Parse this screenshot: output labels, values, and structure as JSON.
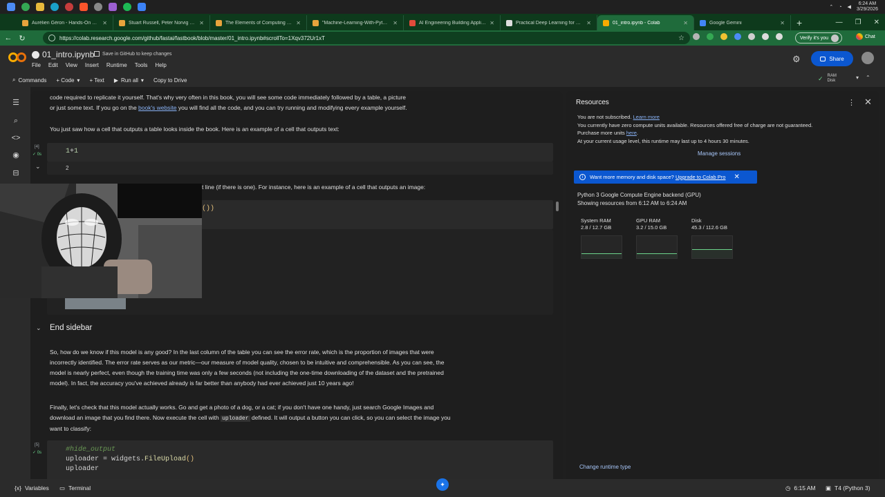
{
  "os": {
    "clock_time": "6:24 AM",
    "clock_date": "3/29/2026"
  },
  "tabs": [
    {
      "title": "Aurélien Géron - Hands-On Machi",
      "color": "#e8a33c"
    },
    {
      "title": "Stuart Russell, Peter Norvig - Artifi",
      "color": "#e8a33c"
    },
    {
      "title": "The Elements of Computing Syste",
      "color": "#e8a33c"
    },
    {
      "title": "\"Machine-Learning-With-Pytorch",
      "color": "#e8a33c"
    },
    {
      "title": "AI Engineering Building Applicatio",
      "color": "#e14b3b"
    },
    {
      "title": "Practical Deep Learning for Coders",
      "color": "#dddddd"
    },
    {
      "title": "01_intro.ipynb - Colab",
      "color": "#f9ab00",
      "active": true
    },
    {
      "title": "Google Gemini",
      "color": "#4285f4"
    }
  ],
  "address": {
    "url": "https://colab.research.google.com/github/fastai/fastbook/blob/master/01_intro.ipynb#scrollTo=1Xqv372Ur1xT",
    "verify_label": "Verify it's you",
    "chat_label": "Chat"
  },
  "colab": {
    "notebook_title": "01_intro.ipynb",
    "save_github": "Save in GitHub to keep changes",
    "menus": [
      "File",
      "Edit",
      "View",
      "Insert",
      "Runtime",
      "Tools",
      "Help"
    ],
    "share_label": "Share",
    "toolbar": {
      "commands": "Commands",
      "code": "+ Code",
      "text": "+ Text",
      "run_all": "Run all",
      "copy_drive": "Copy to Drive"
    },
    "ram_label": "RAM",
    "disk_label": "Disk"
  },
  "notebook": {
    "p1": "code required to replicate it yourself. That's why very often in this book, you will see some code immediately followed by a table, a picture",
    "p1b_pre": "or just some text. If you go on the ",
    "p1b_link": "book's website",
    "p1b_post": " you will find all the code, and you can try running and modifying every example yourself.",
    "p2": "You just saw how a cell that outputs a table looks inside the book. Here is an example of a cell that outputs text:",
    "cell1_num": "[4]",
    "cell1_time": "✓ 0s",
    "cell1_code_a": "1",
    "cell1_code_op": "+",
    "cell1_code_b": "1",
    "cell1_output": "2",
    "p3_visible": "t line (if there is one). For instance, here is an example of a cell that outputs an image:",
    "cell2_visible_code": "())",
    "heading_end_sidebar": "End sidebar",
    "p4": "So, how do we know if this model is any good? In the last column of the table you can see the error rate, which is the proportion of images that were incorrectly identified. The error rate serves as our metric—our measure of model quality, chosen to be intuitive and comprehensible. As you can see, the model is nearly perfect, even though the training time was only a few seconds (not including the one-time downloading of the dataset and the pretrained model). In fact, the accuracy you've achieved already is far better than anybody had ever achieved just 10 years ago!",
    "p5_pre": "Finally, let's check that this model actually works. Go and get a photo of a dog, or a cat; if you don't have one handy, just search Google Images and download an image that you find there. Now execute the cell with ",
    "p5_code": "uploader",
    "p5_post": " defined. It will output a button you can click, so you can select the image you want to classify:",
    "cell3_num": "[5]",
    "cell3_time": "✓ 0s",
    "cell3_line1": "#hide_output",
    "cell3_line2_a": "uploader",
    "cell3_line2_b": " = widgets.",
    "cell3_line2_fn": "FileUpload",
    "cell3_line2_c": "()",
    "cell3_line3": "uploader"
  },
  "resources": {
    "title": "Resources",
    "line1": "You are not subscribed. ",
    "line1_link": "Learn more",
    "line2": "You currently have zero compute units available. Resources offered free of charge are not guaranteed.",
    "line3_pre": "Purchase more units ",
    "line3_link": "here",
    "line3_post": ".",
    "line4": "At your current usage level, this runtime may last up to 4 hours 30 minutes.",
    "manage_sessions": "Manage sessions",
    "banner_text": "Want more memory and disk space? ",
    "banner_link": "Upgrade to Colab Pro",
    "backend": "Python 3 Google Compute Engine backend (GPU)",
    "showing": "Showing resources from 6:12 AM to 6:24 AM",
    "gauges": [
      {
        "name": "System RAM",
        "value": "2.8 / 12.7 GB",
        "used": 0.22
      },
      {
        "name": "GPU RAM",
        "value": "3.2 / 15.0 GB",
        "used": 0.21
      },
      {
        "name": "Disk",
        "value": "45.3 / 112.6 GB",
        "used": 0.4
      }
    ],
    "change_runtime": "Change runtime type"
  },
  "statusbar": {
    "variables": "Variables",
    "terminal": "Terminal",
    "time": "6:15 AM",
    "runtime": "T4 (Python 3)"
  }
}
